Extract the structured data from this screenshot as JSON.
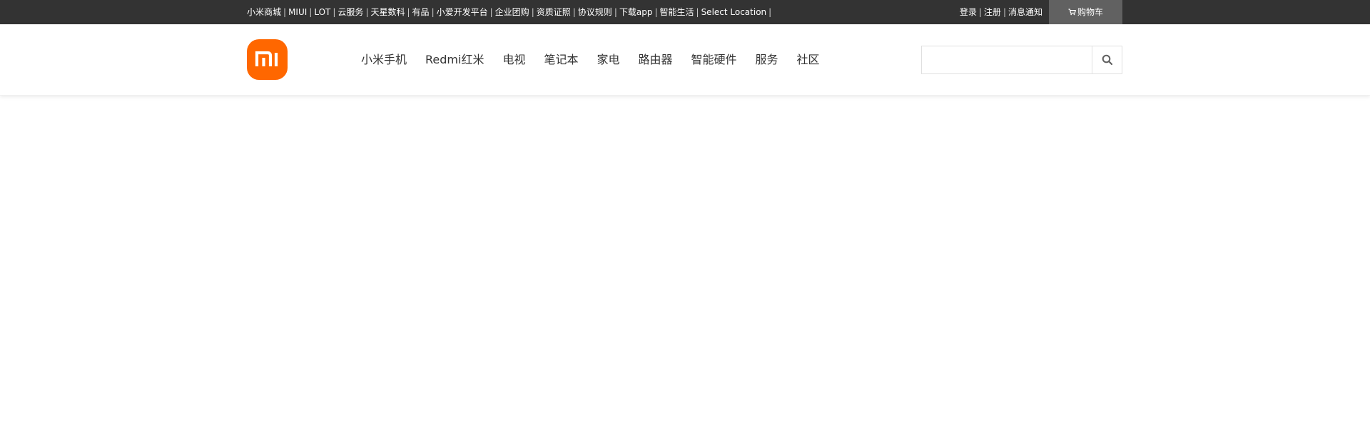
{
  "topbar": {
    "links": [
      "小米商城",
      "MIUI",
      "LOT",
      "云服务",
      "天星数科",
      "有品",
      "小爱开发平台",
      "企业团购",
      "资质证照",
      "协议规则",
      "下载app",
      "智能生活",
      "Select Location"
    ],
    "separator": "|",
    "user_links": [
      "登录",
      "注册",
      "消息通知"
    ],
    "cart_label": "购物车",
    "cart_icon": "cart-icon"
  },
  "header": {
    "logo_icon": "mi-logo",
    "nav": [
      "小米手机",
      "Redmi红米",
      "电视",
      "笔记本",
      "家电",
      "路由器",
      "智能硬件",
      "服务",
      "社区"
    ],
    "search": {
      "value": "",
      "placeholder": "",
      "icon": "search-icon"
    }
  },
  "colors": {
    "topbar_bg": "#333333",
    "cart_bg": "#616161",
    "brand": "#ff6700",
    "nav_text": "#333333"
  }
}
